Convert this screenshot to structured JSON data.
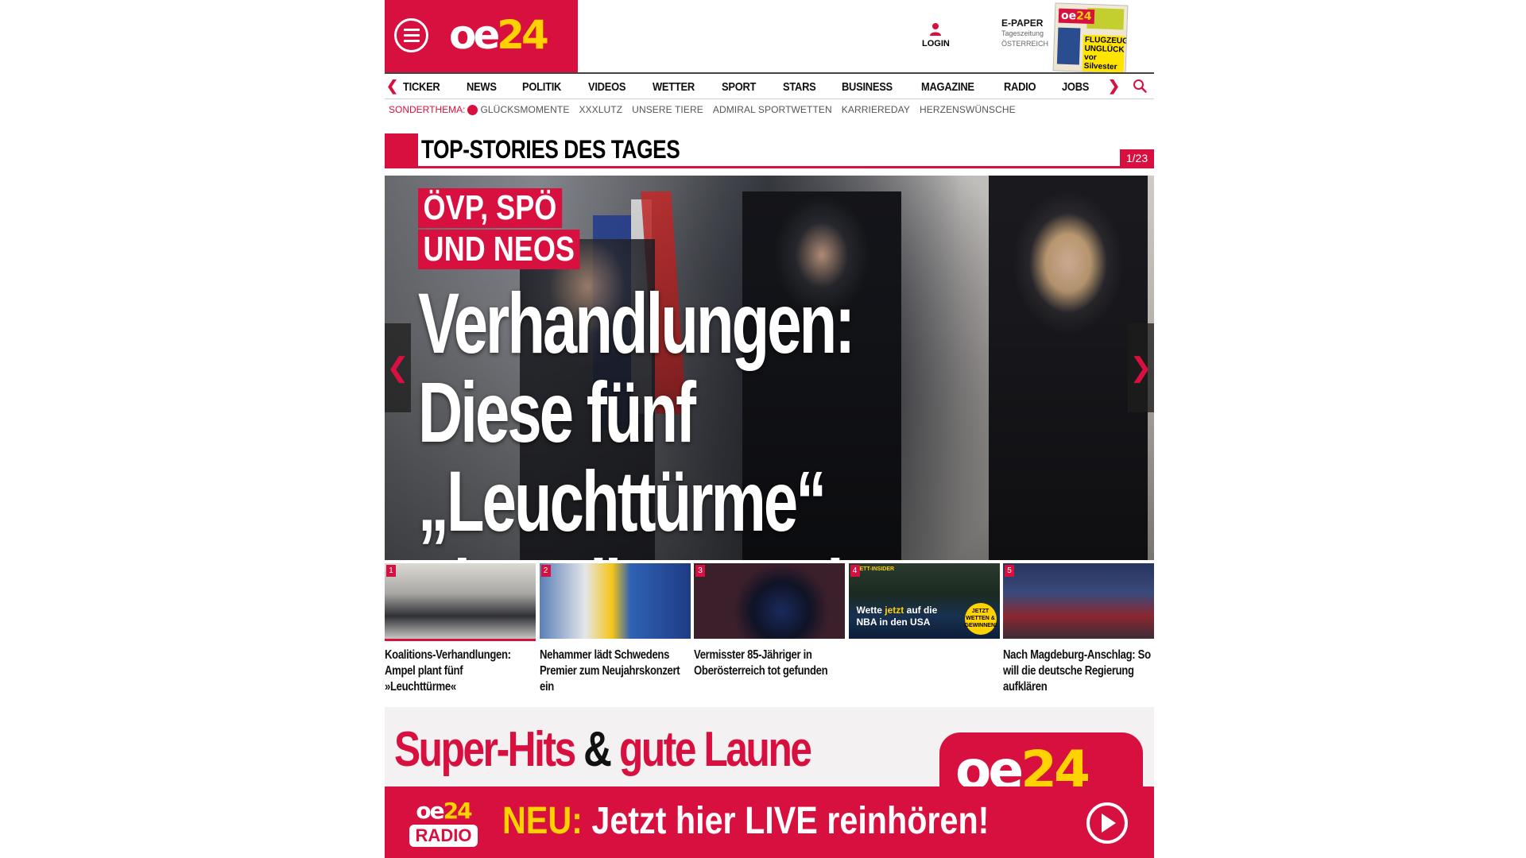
{
  "header": {
    "logo_main": "oe",
    "logo_num": "24",
    "login_label": "LOGIN",
    "epaper_title": "E-PAPER",
    "epaper_sub1": "Tageszeitung",
    "epaper_sub2": "ÖSTERREICH",
    "epaper_thumb_headline": "FLUGZEUG-UNGLÜCK vor Silvester"
  },
  "nav": {
    "items": [
      "TICKER",
      "NEWS",
      "POLITIK",
      "VIDEOS",
      "WETTER",
      "SPORT",
      "STARS",
      "BUSINESS",
      "MAGAZINE",
      "RADIO",
      "JOBS"
    ]
  },
  "sonderthema": {
    "label": "SONDERTHEMA:",
    "items": [
      "GLÜCKSMOMENTE",
      "XXXLUTZ",
      "UNSERE TIERE",
      "ADMIRAL SPORTWETTEN",
      "KARRIEREDAY",
      "HERZENSWÜNSCHE"
    ]
  },
  "top_stories": {
    "title": "TOP-STORIES DES TAGES",
    "counter": "1/23"
  },
  "hero": {
    "kicker_line1": "ÖVP, SPÖ",
    "kicker_line2": "UND NEOS",
    "headline_line1": "Verhandlungen:",
    "headline_line2": "Diese fünf „Leuchttürme“",
    "headline_line3": "plant die Ampel jetzt"
  },
  "thumbs": [
    {
      "num": "1",
      "caption": "Koalitions-Verhandlungen: Ampel plant fünf »Leuchttürme«"
    },
    {
      "num": "2",
      "caption": "Nehammer lädt Schwedens Premier zum Neujahrskonzert ein"
    },
    {
      "num": "3",
      "caption": "Vermisster 85-Jähriger in Oberösterreich tot gefunden"
    },
    {
      "num": "4",
      "caption": "",
      "ad_tag": "ETT-INSIDER",
      "ad_text_1": "Wette",
      "ad_text_hl": "jetzt",
      "ad_text_2": "auf die",
      "ad_text_3": "NBA in den USA",
      "ad_badge": "JETZT WETTEN & GEWINNEN!"
    },
    {
      "num": "5",
      "caption": "Nach Magdeburg-Anschlag: So will die deutsche Regierung aufklären"
    }
  ],
  "ad": {
    "head_part1": "Super-Hits",
    "head_amp": "&",
    "head_part2": "gute Laune",
    "logo_main": "oe",
    "logo_num": "24",
    "radio_top_main": "oe",
    "radio_top_num": "24",
    "radio_bottom": "RADIO",
    "cta_neu": "NEU:",
    "cta_text": "Jetzt hier LIVE reinhören!"
  },
  "colors": {
    "brand_red": "#d8103f",
    "brand_yellow": "#ffd200"
  }
}
